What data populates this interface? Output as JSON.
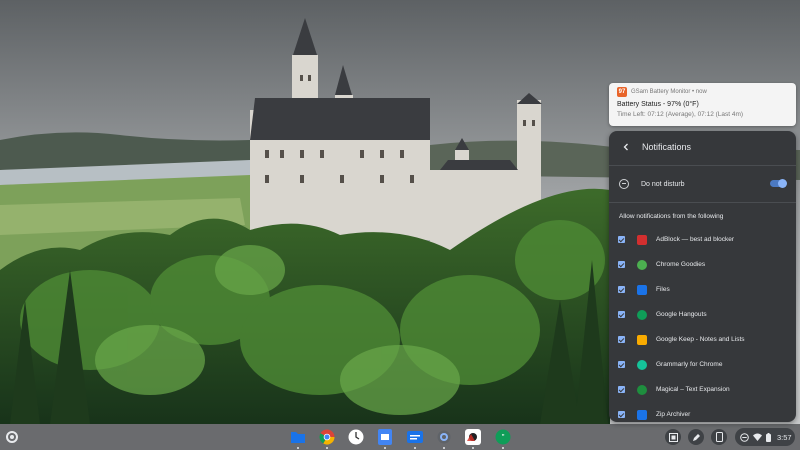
{
  "toast": {
    "app_badge": "97",
    "source": "GSam Battery Monitor • now",
    "title": "Battery Status - 97% (0°F)",
    "body": "Time Left: 07:12 (Average), 07:12 (Last 4m)"
  },
  "panel": {
    "title": "Notifications",
    "dnd_label": "Do not disturb",
    "dnd_enabled": true,
    "section_label": "Allow notifications from the following",
    "apps": [
      {
        "name": "AdBlock — best ad blocker",
        "icon": "adblock-icon",
        "color": "#d32f2f",
        "checked": true
      },
      {
        "name": "Chrome Goodies",
        "icon": "chrome-goodies-icon",
        "color": "#4caf50",
        "checked": true
      },
      {
        "name": "Files",
        "icon": "files-icon",
        "color": "#1a73e8",
        "checked": true
      },
      {
        "name": "Google Hangouts",
        "icon": "hangouts-icon",
        "color": "#0f9d58",
        "checked": true
      },
      {
        "name": "Google Keep - Notes and Lists",
        "icon": "keep-icon",
        "color": "#f9ab00",
        "checked": true
      },
      {
        "name": "Grammarly for Chrome",
        "icon": "grammarly-icon",
        "color": "#15c39a",
        "checked": true
      },
      {
        "name": "Magical – Text Expansion",
        "icon": "magical-icon",
        "color": "#1e8e3e",
        "checked": true
      },
      {
        "name": "Zip Archiver",
        "icon": "zip-archiver-icon",
        "color": "#1a73e8",
        "checked": true
      }
    ]
  },
  "shelf": {
    "apps": [
      "files-icon",
      "chrome-icon",
      "clock-icon",
      "docs-icon",
      "messages-icon",
      "settings-icon",
      "camera-icon",
      "hangouts-icon"
    ],
    "time": "3:57"
  },
  "colors": {
    "accent": "#8ab4f8",
    "panel_bg": "#36383b",
    "toast_bg": "#f4f4f4"
  }
}
